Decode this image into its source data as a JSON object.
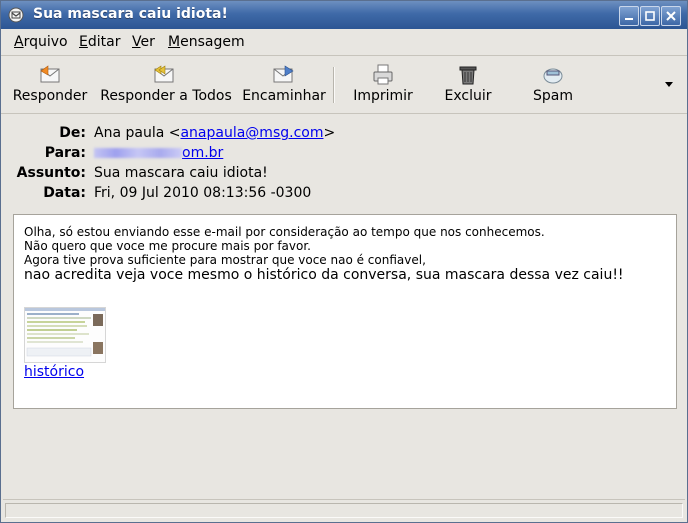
{
  "window": {
    "title": "Sua mascara caiu idiota!"
  },
  "menubar": {
    "items": [
      {
        "accel": "A",
        "rest": "rquivo"
      },
      {
        "accel": "E",
        "rest": "ditar"
      },
      {
        "accel": "V",
        "rest": "er"
      },
      {
        "accel": "M",
        "rest": "ensagem"
      }
    ]
  },
  "toolbar": {
    "reply_label": "Responder",
    "reply_all_label": "Responder a Todos",
    "forward_label": "Encaminhar",
    "print_label": "Imprimir",
    "delete_label": "Excluir",
    "spam_label": "Spam"
  },
  "headers": {
    "from_label": "De:",
    "from_name": "Ana paula <",
    "from_email": "anapaula@msg.com",
    "from_close": ">",
    "to_label": "Para:",
    "to_visible_suffix": "om.br",
    "subject_label": "Assunto:",
    "subject_value": "Sua mascara caiu idiota!",
    "date_label": "Data:",
    "date_value": "Fri, 09 Jul 2010 08:13:56 -0300"
  },
  "message": {
    "lines": [
      "Olha, só estou enviando esse e-mail por consideração ao tempo que nos conhecemos.",
      "Não quero que voce me procure mais por favor.",
      "Agora tive prova suficiente para mostrar que voce nao é confiavel,",
      "nao acredita veja voce mesmo o histórico da conversa, sua mascara dessa vez caiu!!"
    ],
    "attachment_link": "histórico"
  },
  "colors": {
    "titlebar": "#3f6aa8",
    "link": "#0000ee"
  }
}
